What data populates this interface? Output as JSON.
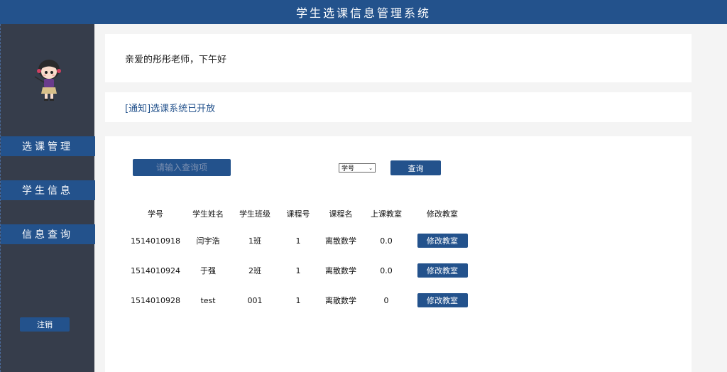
{
  "app": {
    "title": "学生选课信息管理系统"
  },
  "sidebar": {
    "avatar": "teacher-avatar",
    "items": [
      {
        "label": "选课管理"
      },
      {
        "label": "学生信息"
      },
      {
        "label": "信息查询"
      }
    ],
    "logout_label": "注销"
  },
  "greeting": "亲爱的彤彤老师，下午好",
  "notice": "[通知]选课系统已开放",
  "search": {
    "placeholder": "请输入查询项",
    "select_value": "学号",
    "query_label": "查询"
  },
  "table": {
    "headers": [
      "学号",
      "学生姓名",
      "学生班级",
      "课程号",
      "课程名",
      "上课教室",
      "修改教室"
    ],
    "rows": [
      {
        "id": "1514010918",
        "name": "闫宇浩",
        "class": "1班",
        "course_no": "1",
        "course": "离散数学",
        "room": "0.0",
        "action": "修改教室"
      },
      {
        "id": "1514010924",
        "name": "于强",
        "class": "2班",
        "course_no": "1",
        "course": "离散数学",
        "room": "0.0",
        "action": "修改教室"
      },
      {
        "id": "1514010928",
        "name": "test",
        "class": "001",
        "course_no": "1",
        "course": "离散数学",
        "room": "0",
        "action": "修改教室"
      }
    ]
  },
  "colors": {
    "accent": "#23528c",
    "sidebar": "#363d4b",
    "background": "#f4f4f4"
  }
}
